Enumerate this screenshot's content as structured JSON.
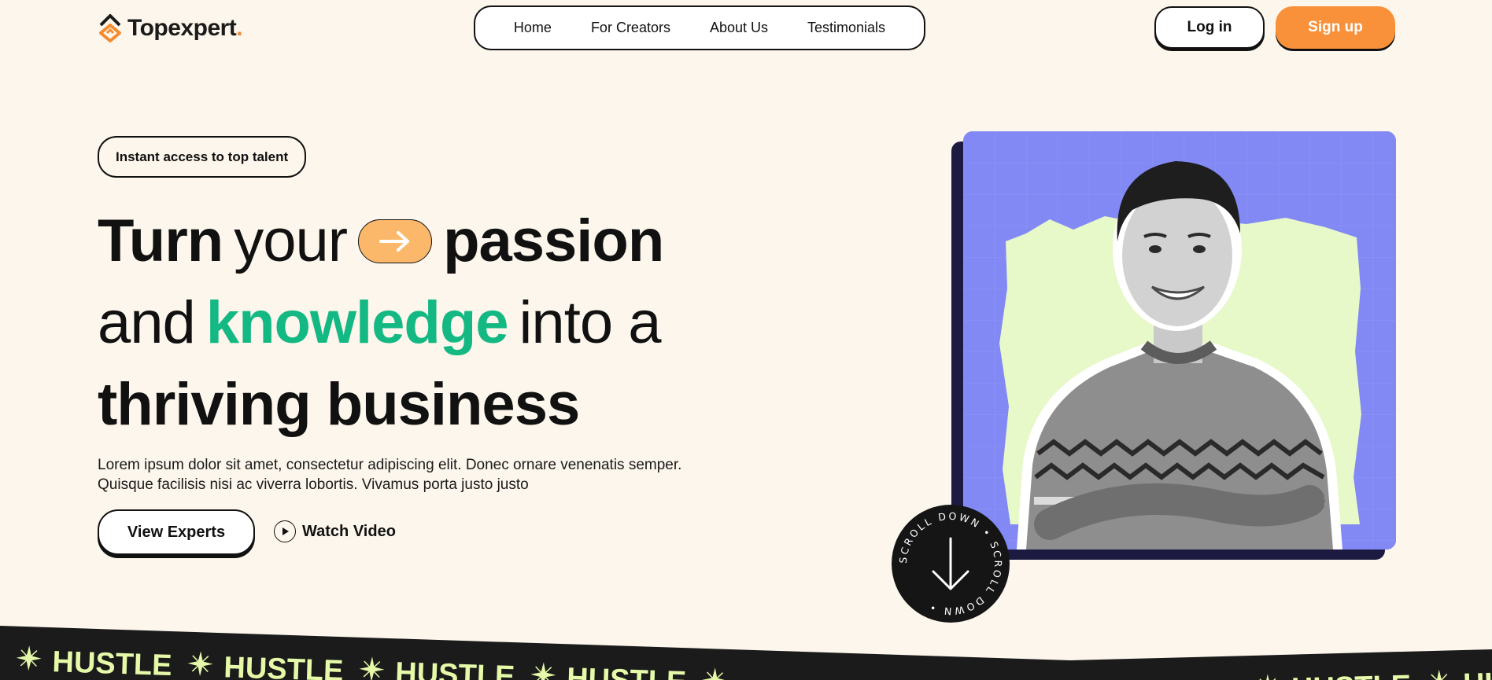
{
  "brand": {
    "name": "Topexpert",
    "dot": ".",
    "accent": "#f48b2f"
  },
  "nav": {
    "items": [
      {
        "label": "Home"
      },
      {
        "label": "For Creators"
      },
      {
        "label": "About Us"
      },
      {
        "label": "Testimonials"
      }
    ]
  },
  "auth": {
    "login_label": "Log in",
    "signup_label": "Sign up",
    "signup_color": "#f8913a"
  },
  "hero": {
    "badge": "Instant access to top talent",
    "headline": {
      "line1_a": "Turn",
      "line1_b": "your",
      "line1_c": "passion",
      "line2_a": "and",
      "line2_b": "knowledge",
      "line2_c": "into a",
      "line3": "thriving business"
    },
    "highlight_color": "#14b883",
    "description": "Lorem ipsum dolor sit amet, consectetur adipiscing elit. Donec ornare venenatis semper. Quisque facilisis nisi ac viverra lobortis. Vivamus porta justo justo",
    "primary_button": "View Experts",
    "video_link": "Watch Video"
  },
  "scroll": {
    "label": "SCROLL DOWN • SCROLL DOWN •"
  },
  "ticker": {
    "word": "HUSTLE",
    "icon": "sparkle-icon",
    "color": "#e5f9a8"
  },
  "photo": {
    "background": "#8289f4",
    "subject": "smiling man in patterned sweater",
    "icon": "person-photo"
  }
}
